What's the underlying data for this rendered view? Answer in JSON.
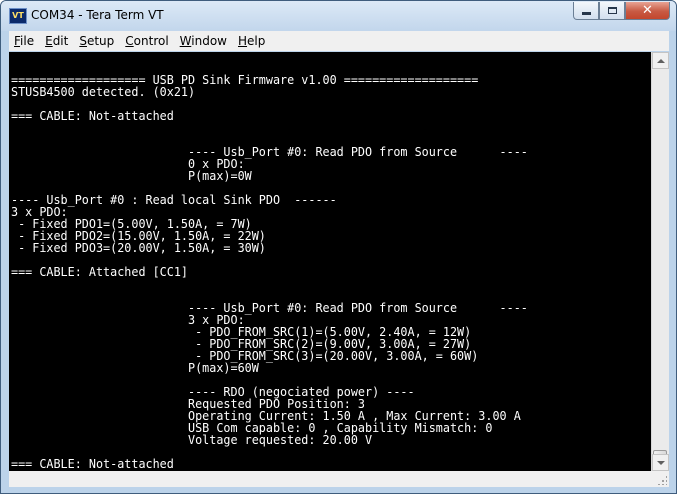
{
  "window": {
    "title": "COM34 - Tera Term VT",
    "app_icon_label": "VT",
    "icon": "tera-term-icon"
  },
  "caption_buttons": {
    "minimize_icon": "minimize-icon",
    "maximize_icon": "maximize-icon",
    "close_glyph": "✕"
  },
  "menu": {
    "items": [
      {
        "accel": "F",
        "rest": "ile"
      },
      {
        "accel": "E",
        "rest": "dit"
      },
      {
        "accel": "S",
        "rest": "etup"
      },
      {
        "accel": "C",
        "rest": "ontrol"
      },
      {
        "accel": "W",
        "rest": "indow"
      },
      {
        "accel": "H",
        "rest": "elp"
      }
    ]
  },
  "terminal": {
    "background": "#000000",
    "foreground": "#ffffff",
    "lines": [
      "=================== USB PD Sink Firmware v1.00 ===================",
      "STUSB4500 detected. (0x21)",
      "",
      "=== CABLE: Not-attached",
      "",
      "",
      "                         ---- Usb_Port #0: Read PDO from Source      ----",
      "                         0 x PDO:",
      "                         P(max)=0W",
      "",
      "---- Usb_Port #0 : Read local Sink PDO  ------",
      "3 x PDO:",
      " - Fixed PDO1=(5.00V, 1.50A, = 7W)",
      " - Fixed PDO2=(15.00V, 1.50A, = 22W)",
      " - Fixed PDO3=(20.00V, 1.50A, = 30W)",
      "",
      "=== CABLE: Attached [CC1]",
      "",
      "",
      "                         ---- Usb_Port #0: Read PDO from Source      ----",
      "                         3 x PDO:",
      "                          - PDO_FROM_SRC(1)=(5.00V, 2.40A, = 12W)",
      "                          - PDO_FROM_SRC(2)=(9.00V, 3.00A, = 27W)",
      "                          - PDO_FROM_SRC(3)=(20.00V, 3.00A, = 60W)",
      "                         P(max)=60W",
      "",
      "                         ---- RDO (negociated power) ----",
      "                         Requested PDO Position: 3",
      "                         Operating Current: 1.50 A , Max Current: 3.00 A",
      "                         USB Com capable: 0 , Capability Mismatch: 0",
      "                         Voltage requested: 20.00 V",
      "",
      "=== CABLE: Not-attached"
    ]
  },
  "scrollbar": {
    "up_icon": "scroll-up-arrow-icon",
    "down_icon": "scroll-down-arrow-icon",
    "position": "bottom"
  }
}
